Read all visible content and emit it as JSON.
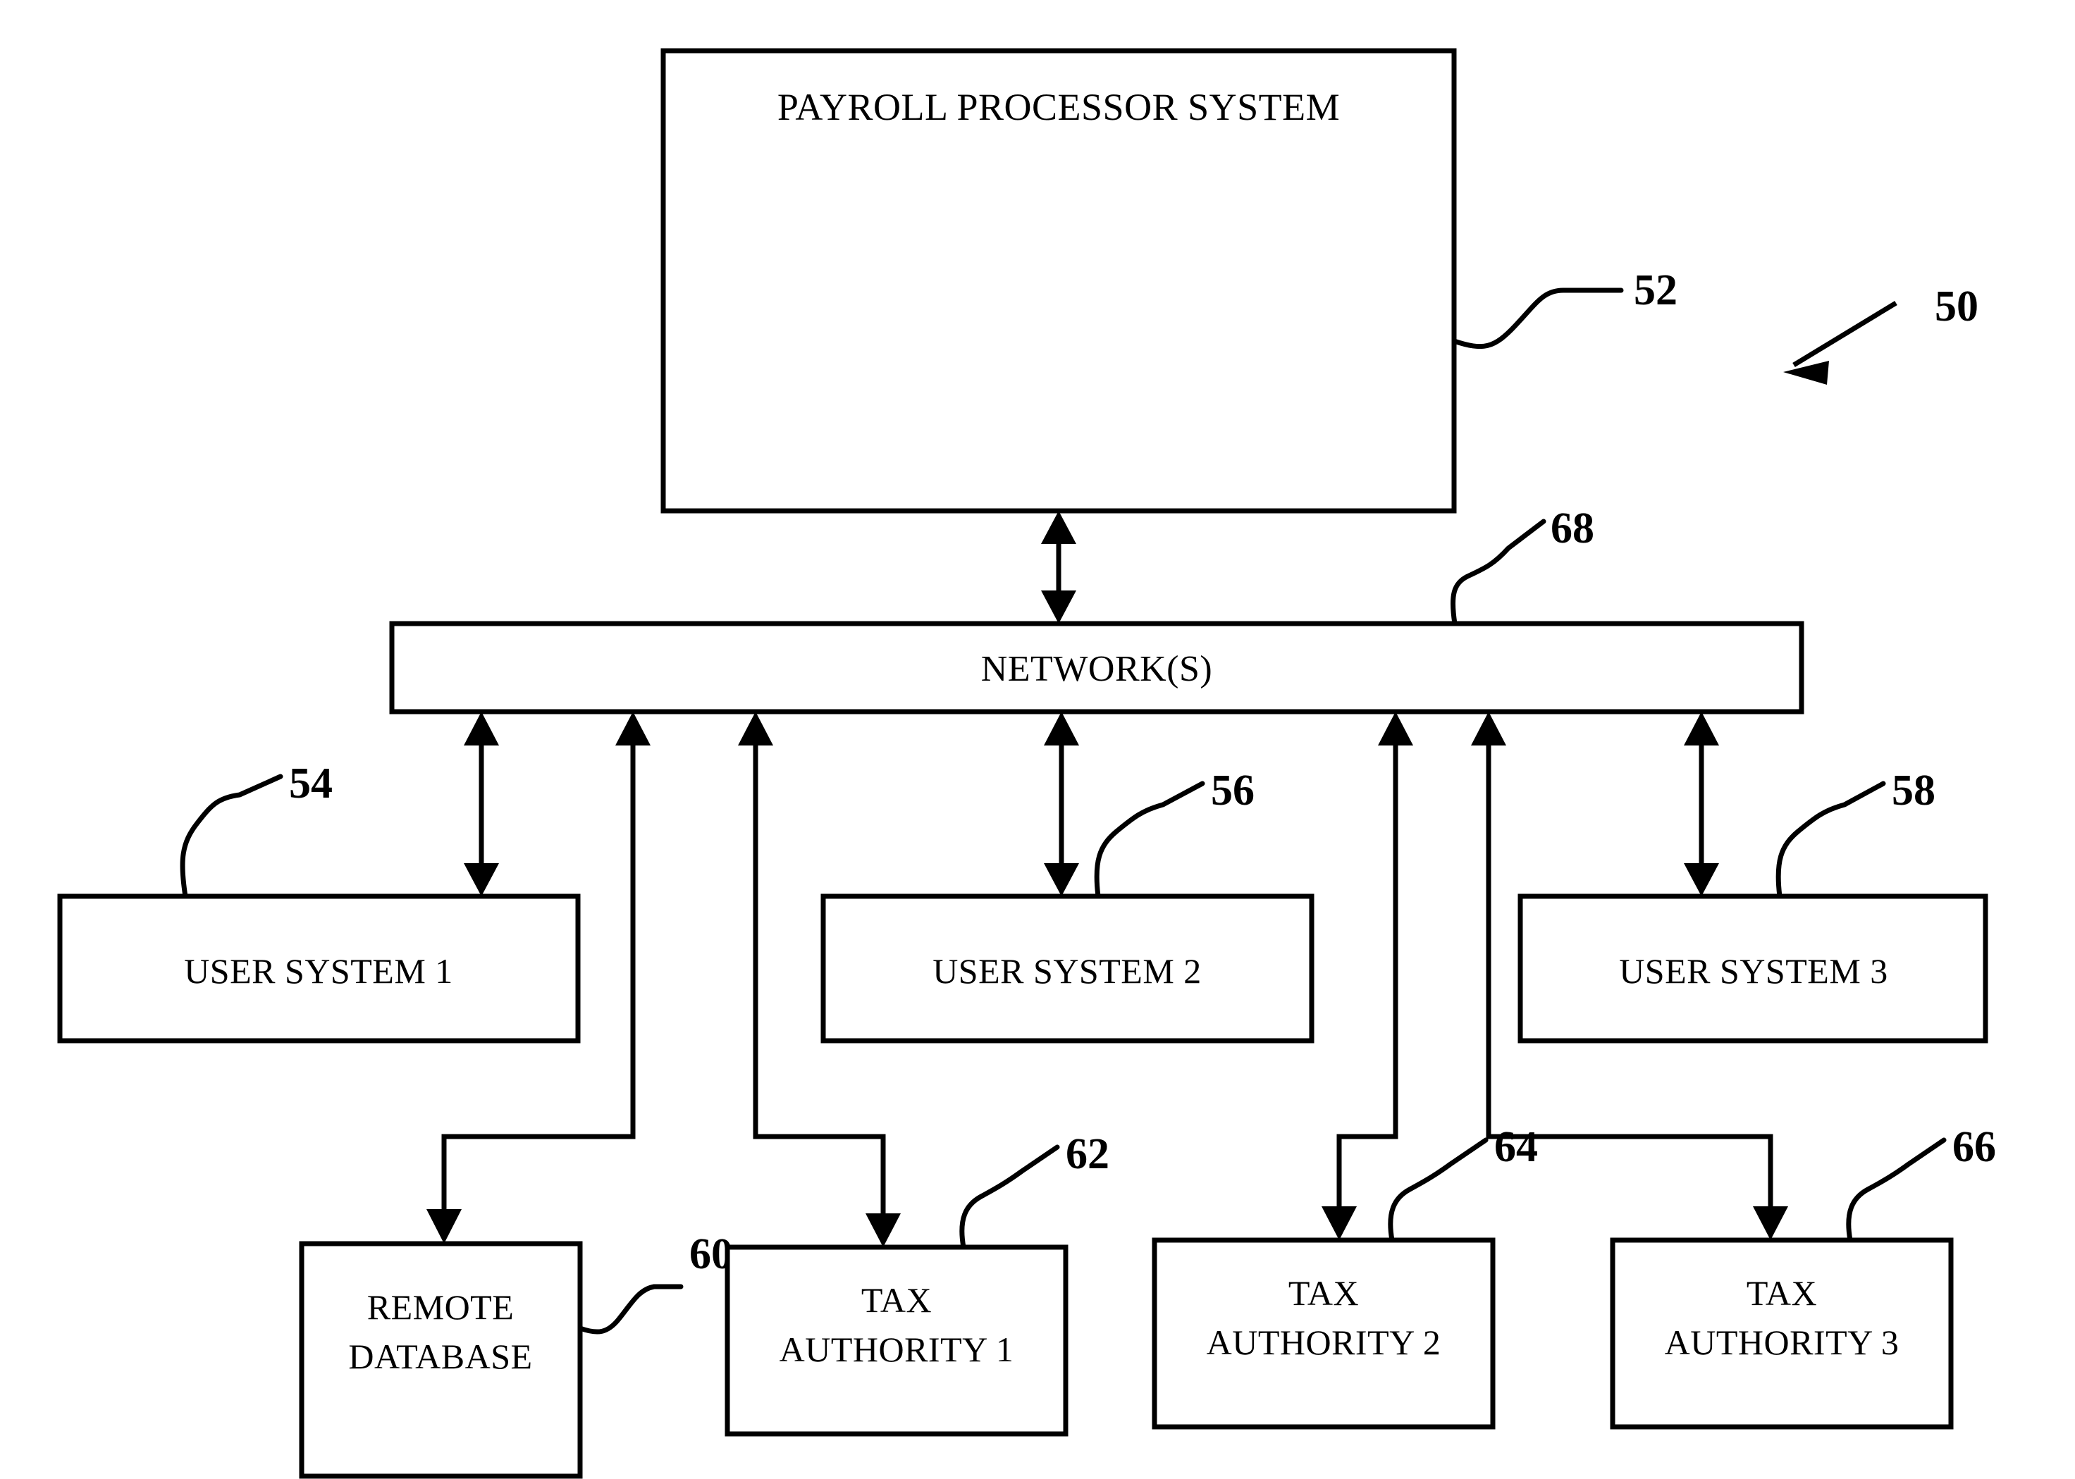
{
  "figure": {
    "type": "patent-block-diagram",
    "figure_reference": "50",
    "background_color": "#ffffff",
    "line_color": "#000000"
  },
  "blocks": {
    "payroll_processor": {
      "label": "PAYROLL PROCESSOR SYSTEM",
      "ref": "52"
    },
    "network": {
      "label": "NETWORK(S)",
      "ref": "68"
    },
    "user_system_1": {
      "label": "USER SYSTEM 1",
      "ref": "54"
    },
    "user_system_2": {
      "label": "USER SYSTEM 2",
      "ref": "56"
    },
    "user_system_3": {
      "label": "USER SYSTEM 3",
      "ref": "58"
    },
    "remote_database": {
      "label_line_1": "REMOTE",
      "label_line_2": "DATABASE",
      "ref": "60"
    },
    "tax_authority_1": {
      "label_line_1": "TAX",
      "label_line_2": "AUTHORITY 1",
      "ref": "62"
    },
    "tax_authority_2": {
      "label_line_1": "TAX",
      "label_line_2": "AUTHORITY 2",
      "ref": "64"
    },
    "tax_authority_3": {
      "label_line_1": "TAX",
      "label_line_2": "AUTHORITY 3",
      "ref": "66"
    }
  },
  "reference_numerals": {
    "figure_50": "50",
    "payroll_52": "52",
    "user_54": "54",
    "user_56": "56",
    "user_58": "58",
    "database_60": "60",
    "tax_62": "62",
    "tax_64": "64",
    "tax_66": "66",
    "network_68": "68"
  }
}
